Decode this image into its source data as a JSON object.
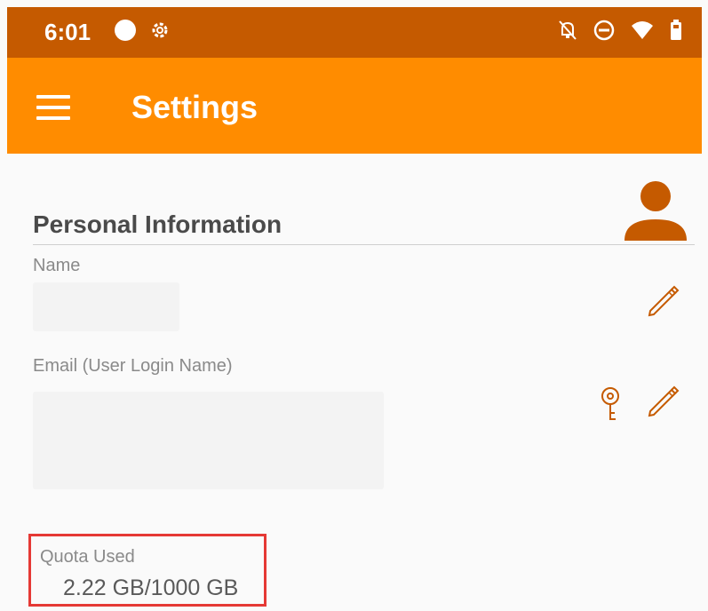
{
  "status_bar": {
    "time": "6:01",
    "left_icons": [
      "circle-icon",
      "gear-icon"
    ],
    "right_icons": [
      "notifications-off-icon",
      "do-not-disturb-icon",
      "wifi-icon",
      "battery-icon"
    ],
    "color": "#c55a00"
  },
  "app_bar": {
    "title": "Settings",
    "color": "#ff8c00"
  },
  "personal_info": {
    "title": "Personal Information",
    "name_label": "Name",
    "email_label": "Email (User Login Name)"
  },
  "quota": {
    "label": "Quota Used",
    "value": "2.22 GB/1000 GB"
  },
  "accent_color": "#c55a00"
}
